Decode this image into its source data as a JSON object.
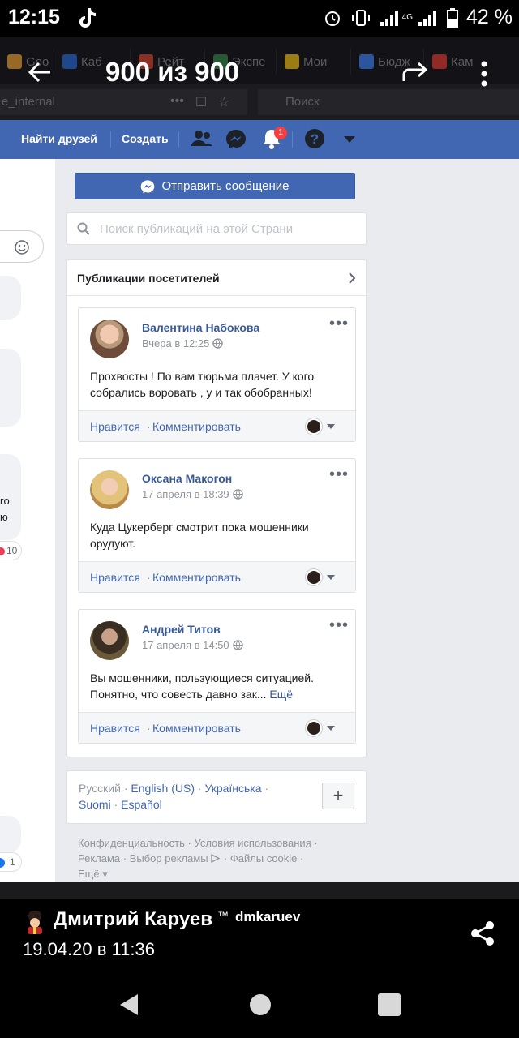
{
  "status_bar": {
    "time": "12:15",
    "battery": "42 %",
    "network": "4G"
  },
  "viewer": {
    "counter": "900 из 900"
  },
  "browser": {
    "tabs": [
      "Goo",
      "Каб",
      "Рейт",
      "Экспе",
      "Мои",
      "Бюдж",
      "Кам"
    ],
    "url_fragment": "e_internal",
    "search_placeholder": "Поиск"
  },
  "fb_nav": {
    "find_friends": "Найти друзей",
    "create": "Создать",
    "notification_count": "1"
  },
  "left_column": {
    "fragment_text_1": "го",
    "fragment_text_2": "ю",
    "count_a": "10",
    "count_b": "1"
  },
  "send_message_button": "Отправить сообщение",
  "page_search_placeholder": "Поиск публикаций на этой Страни",
  "visitor_posts": {
    "title": "Публикации посетителей",
    "posts": [
      {
        "author": "Валентина Набокова",
        "time": "Вчера в 12:25",
        "text": "Прохвосты ! По вам тюрьма плачет. У кого собрались воровать , у и так обобранных!",
        "more": "",
        "like": "Нравится",
        "separator": "·",
        "comment": "Комментировать"
      },
      {
        "author": "Оксана Макогон",
        "time": "17 апреля в 18:39",
        "text": "Куда Цукерберг смотрит пока мошенники орудуют.",
        "more": "",
        "like": "Нравится",
        "separator": "·",
        "comment": "Комментировать"
      },
      {
        "author": "Андрей Титов",
        "time": "17 апреля в 14:50",
        "text": "Вы мошенники, пользующиеся ситуацией. Понятно, что совесть давно зак...",
        "more": "Ещё",
        "like": "Нравится",
        "separator": "·",
        "comment": "Комментировать"
      }
    ]
  },
  "languages": {
    "current": "Русский",
    "options": [
      "English (US)",
      "Українська",
      "Suomi",
      "Español"
    ],
    "add": "+"
  },
  "footer": {
    "links": [
      "Конфиденциальность",
      "Условия использования",
      "Реклама",
      "Выбор рекламы",
      "Файлы cookie",
      "Ещё"
    ]
  },
  "poster": {
    "name": "Дмитрий Каруев",
    "tm": "™",
    "username": "dmkaruev",
    "date": "19.04.20 в 11:36"
  },
  "colors": {
    "facebook_blue": "#4267b2",
    "link_blue": "#385898",
    "page_bg": "#e9ebee"
  }
}
